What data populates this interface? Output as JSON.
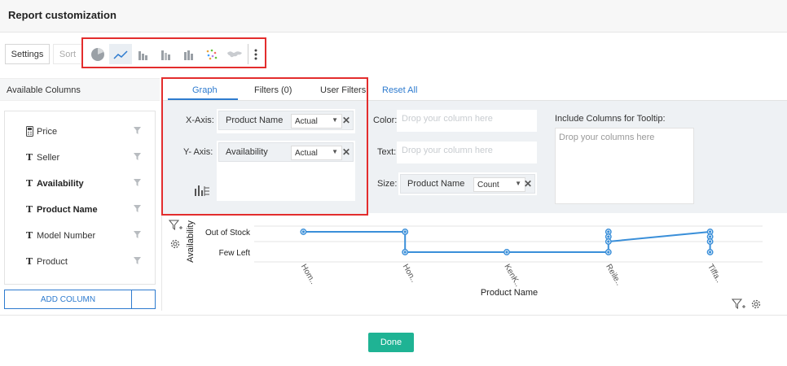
{
  "header": {
    "title": "Report customization"
  },
  "toolbar": {
    "settings_label": "Settings",
    "sort_label": "Sort",
    "chart_types": [
      "pie-chart-icon",
      "line-chart-icon",
      "bar-chart-icon",
      "stacked-bar-icon",
      "column-chart-icon",
      "scatter-chart-icon",
      "map-chart-icon"
    ],
    "active_chart": "line-chart-icon"
  },
  "sidebar": {
    "title": "Available Columns",
    "columns": [
      {
        "label": "Price",
        "type": "calculator",
        "bold": false
      },
      {
        "label": "Seller",
        "type": "text",
        "bold": false
      },
      {
        "label": "Availability",
        "type": "text",
        "bold": true
      },
      {
        "label": "Product Name",
        "type": "text",
        "bold": true
      },
      {
        "label": "Model Number",
        "type": "text",
        "bold": false
      },
      {
        "label": "Product",
        "type": "text",
        "bold": false
      }
    ],
    "add_column_label": "ADD COLUMN"
  },
  "tabs": [
    {
      "label": "Graph",
      "active": true
    },
    {
      "label": "Filters (0)",
      "active": false
    },
    {
      "label": "User Filters",
      "active": false
    }
  ],
  "reset_label": "Reset All",
  "axes": {
    "x": {
      "label": "X-Axis:",
      "field": "Product Name",
      "agg": "Actual"
    },
    "y": {
      "label": "Y- Axis:",
      "field": "Availability",
      "agg": "Actual"
    }
  },
  "encodings": {
    "color_label": "Color:",
    "color_placeholder": "Drop your column here",
    "text_label": "Text:",
    "text_placeholder": "Drop your column here",
    "size_label": "Size:",
    "size_field": "Product Name",
    "size_agg": "Count"
  },
  "tooltip": {
    "label": "Include Columns for Tooltip:",
    "placeholder": "Drop your columns here"
  },
  "chart_data": {
    "type": "line",
    "xlabel": "Product Name",
    "ylabel": "Availability",
    "categories": [
      "Hom..",
      "Hon..",
      "KenK..",
      "Reile..",
      "Tiffa.."
    ],
    "y_categories": [
      "Few Left",
      "Out of Stock"
    ],
    "series": [
      {
        "points": [
          {
            "x": "Hom..",
            "y": "Out of Stock"
          },
          {
            "x": "Hon..",
            "y": "Out of Stock"
          },
          {
            "x": "Hon..",
            "y": "Few Left"
          },
          {
            "x": "KenK..",
            "y": "Few Left"
          },
          {
            "x": "Reile..",
            "y": "Few Left"
          },
          {
            "x": "Reile..",
            "y": "Out of Stock"
          },
          {
            "x": "Reile..",
            "y": "Out of Stock"
          },
          {
            "x": "Reile..",
            "y": "Out of Stock"
          },
          {
            "x": "Tiffa..",
            "y": "Out of Stock"
          },
          {
            "x": "Tiffa..",
            "y": "Out of Stock"
          },
          {
            "x": "Tiffa..",
            "y": "Out of Stock"
          },
          {
            "x": "Tiffa..",
            "y": "Few Left"
          }
        ]
      }
    ],
    "color": "#3a8fd9",
    "grid": true
  },
  "footer": {
    "done_label": "Done"
  }
}
